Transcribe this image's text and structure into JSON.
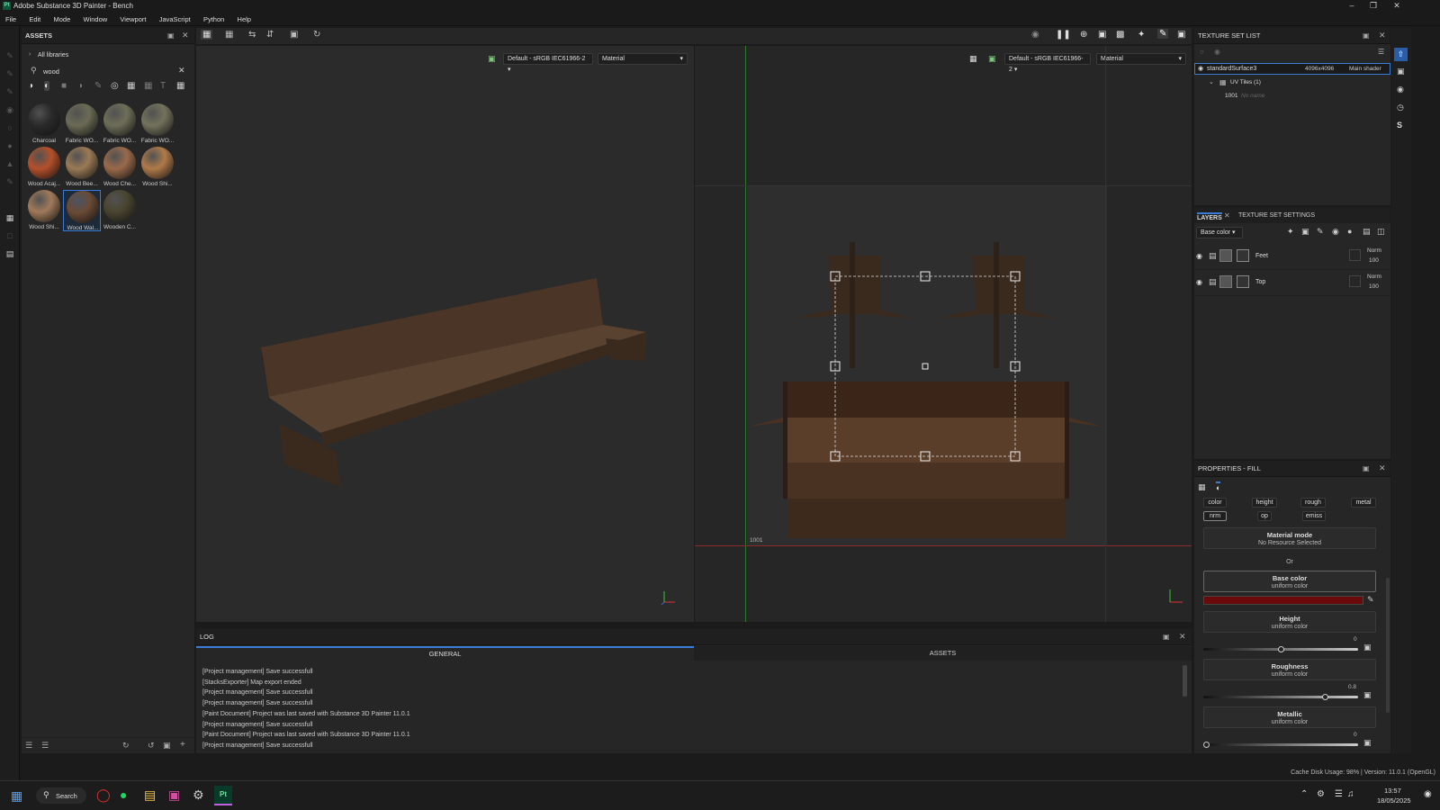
{
  "app": {
    "title": "Adobe Substance 3D Painter - Bench",
    "logo": "Pt"
  },
  "menu": [
    "File",
    "Edit",
    "Mode",
    "Window",
    "Viewport",
    "JavaScript",
    "Python",
    "Help"
  ],
  "assets": {
    "header": "ASSETS",
    "breadcrumb": "All libraries",
    "search_value": "wood",
    "items": [
      {
        "label": "Charcoal",
        "color": "#2a2a2a"
      },
      {
        "label": "Fabric WO...",
        "color": "#6b6b55"
      },
      {
        "label": "Fabric WO...",
        "color": "#6e6e58"
      },
      {
        "label": "Fabric WO...",
        "color": "#72725c"
      },
      {
        "label": "Wood Acaj...",
        "color": "#b4502a"
      },
      {
        "label": "Wood Bee...",
        "color": "#9a7a55"
      },
      {
        "label": "Wood Che...",
        "color": "#9a6a4a"
      },
      {
        "label": "Wood Shi...",
        "color": "#b07a4a"
      },
      {
        "label": "Wood Shi...",
        "color": "#a07a5a"
      },
      {
        "label": "Wood Wal...",
        "color": "#6a4a35"
      },
      {
        "label": "Wooden C...",
        "color": "#4a4530"
      }
    ]
  },
  "viewport3d": {
    "colorspace": "Default - sRGB IEC61966-2",
    "mode": "Material"
  },
  "viewport2d": {
    "colorspace": "Default - sRGB IEC61966-2",
    "mode": "Material",
    "uv_tile": "1001"
  },
  "texture_set": {
    "header": "TEXTURE SET LIST",
    "name": "standardSurface3",
    "size": "4096x4096",
    "shader": "Main shader",
    "uv_tiles": "UV Tiles (1)",
    "tile_id": "1001",
    "tile_name": "No name"
  },
  "layers": {
    "tab1": "LAYERS",
    "tab2": "TEXTURE SET SETTINGS",
    "channel": "Base color",
    "items": [
      {
        "name": "Feet",
        "blend": "Norm",
        "opacity": "100"
      },
      {
        "name": "Top",
        "blend": "Norm",
        "opacity": "100"
      }
    ]
  },
  "properties": {
    "header": "PROPERTIES - FILL",
    "channels_row1": [
      "color",
      "height",
      "rough",
      "metal"
    ],
    "channels_row2": [
      "nrm",
      "op",
      "emiss"
    ],
    "material_mode": "Material mode",
    "no_resource": "No Resource Selected",
    "or": "Or",
    "uniform": "uniform color",
    "base_color": "Base color",
    "base_color_value": "#6a0a0a",
    "height": "Height",
    "height_value": "0",
    "height_level": 0.5,
    "roughness": "Roughness",
    "roughness_value": "0.8",
    "roughness_level": 0.8,
    "metallic": "Metallic",
    "metallic_value": "0",
    "metallic_level": 0
  },
  "log": {
    "header": "LOG",
    "tab_general": "GENERAL",
    "tab_assets": "ASSETS",
    "lines": [
      "[Project management] Save successfull",
      "[StacksExporter] Map export ended",
      "[Project management] Save successfull",
      "[Project management] Save successfull",
      "[Paint Document] Project was last saved with Substance 3D Painter 11.0.1",
      "[Project management] Save successfull",
      "[Paint Document] Project was last saved with Substance 3D Painter 11.0.1",
      "[Project management] Save successfull"
    ]
  },
  "status": "Cache Disk Usage:  98% | Version: 11.0.1 (OpenGL)",
  "taskbar": {
    "search": "Search",
    "time": "13:57",
    "date": "18/05/2025"
  }
}
